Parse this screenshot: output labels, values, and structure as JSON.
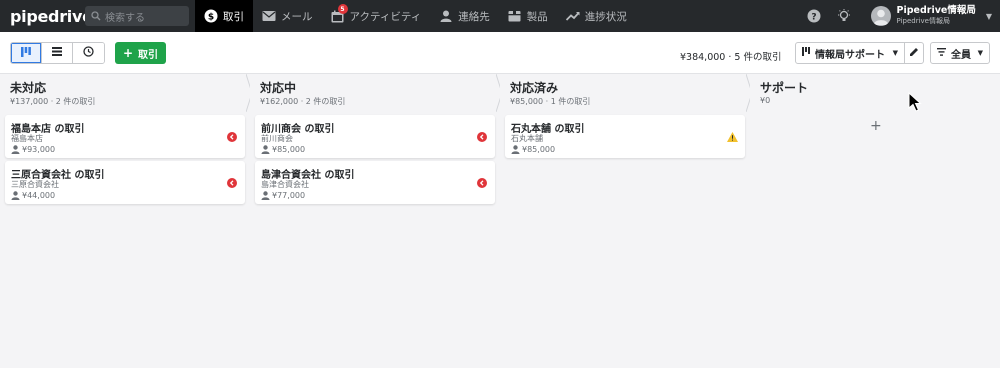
{
  "nav": {
    "logo": "pipedrive",
    "search_placeholder": "検索する",
    "items": [
      {
        "label": "取引",
        "icon": "dollar-icon",
        "active": true
      },
      {
        "label": "メール",
        "icon": "mail-icon"
      },
      {
        "label": "アクティビティ",
        "icon": "calendar-icon",
        "badge": "5"
      },
      {
        "label": "連絡先",
        "icon": "person-icon"
      },
      {
        "label": "製品",
        "icon": "box-icon"
      },
      {
        "label": "進捗状況",
        "icon": "trend-icon"
      }
    ],
    "user": {
      "name": "Pipedrive情報局",
      "company": "Pipedrive情報局"
    }
  },
  "toolbar": {
    "add_label": "取引",
    "summary": "¥384,000 · 5 件の取引",
    "pipeline": "情報局サポート",
    "filter": "全員"
  },
  "stages": [
    {
      "name": "未対応",
      "summary": "¥137,000 · 2 件の取引",
      "deals": [
        {
          "title": "福島本店 の取引",
          "org": "福島本店",
          "value": "¥93,000",
          "status": "overdue"
        },
        {
          "title": "三原合資会社 の取引",
          "org": "三原合資会社",
          "value": "¥44,000",
          "status": "overdue"
        }
      ]
    },
    {
      "name": "対応中",
      "summary": "¥162,000 · 2 件の取引",
      "deals": [
        {
          "title": "前川商会 の取引",
          "org": "前川商会",
          "value": "¥85,000",
          "status": "overdue"
        },
        {
          "title": "島津合資会社 の取引",
          "org": "島津合資会社",
          "value": "¥77,000",
          "status": "overdue"
        }
      ]
    },
    {
      "name": "対応済み",
      "summary": "¥85,000 · 1 件の取引",
      "deals": [
        {
          "title": "石丸本舗 の取引",
          "org": "石丸本舗",
          "value": "¥85,000",
          "status": "warning"
        }
      ]
    },
    {
      "name": "サポート",
      "summary": "¥0",
      "deals": []
    }
  ],
  "colors": {
    "nav_bg": "#26292c",
    "accent_green": "#1fa34a",
    "overdue": "#e0353a",
    "warning": "#f2c12e"
  }
}
